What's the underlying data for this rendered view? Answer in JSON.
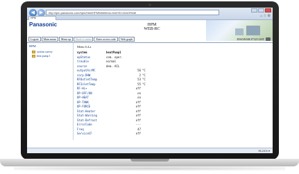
{
  "browser": {
    "address": "http://lpm.panasonic.com/hpm/html/HPMWebMenu.html?ID=DIAGRAM",
    "tab_label": "HPM",
    "back_symbol": "◀",
    "forward_symbol": "▶",
    "tool_icons": "⌂ ☆ ⚙"
  },
  "header": {
    "brand": "Panasonic",
    "title_line1": "HPM",
    "title_line2": "WEB-RC",
    "diagram_label": "DIAGRAM 4*123 LIST"
  },
  "toolbar": {
    "buttons": [
      "Logout",
      "Main menu",
      "Menu up",
      "Back to menu",
      "Enter access code",
      "Web graph"
    ]
  },
  "tree": {
    "root": "HPM",
    "items": [
      "system survey",
      "heat pump 1"
    ]
  },
  "main": {
    "menu_id": "Menu 6.4.a",
    "header_row": {
      "key": "system",
      "value": "heatPump1"
    },
    "rows": [
      {
        "key": "opStatus",
        "value": "com. oper.",
        "unit": ""
      },
      {
        "key": "trouble",
        "value": "normal",
        "unit": ""
      },
      {
        "key": "source",
        "value": "dem. ACL",
        "unit": ""
      },
      {
        "key": "outputAirMC",
        "value": "56",
        "unit": "°C"
      },
      {
        "key": "corp.DHW",
        "value": "2",
        "unit": "°C"
      },
      {
        "key": "RFOutletTemp",
        "value": "53",
        "unit": "°C"
      },
      {
        "key": "RFInletTemp",
        "value": "55",
        "unit": "°C"
      },
      {
        "key": "RF-Hi+",
        "value": "off",
        "unit": ""
      },
      {
        "key": "OP-OFF/ON",
        "value": "on",
        "unit": ""
      },
      {
        "key": "OP-HEAT",
        "value": "on",
        "unit": ""
      },
      {
        "key": "OP-TANK",
        "value": "off",
        "unit": ""
      },
      {
        "key": "OP-FORCE",
        "value": "off",
        "unit": ""
      },
      {
        "key": "Stat-Heater",
        "value": "off",
        "unit": ""
      },
      {
        "key": "Stat-Warning",
        "value": "off",
        "unit": ""
      },
      {
        "key": "Stat-Defrost",
        "value": "off",
        "unit": ""
      },
      {
        "key": "ErrorCode",
        "value": "---",
        "unit": ""
      },
      {
        "key": "Freq",
        "value": "47",
        "unit": ""
      },
      {
        "key": "ServiceCF",
        "value": "off",
        "unit": ""
      }
    ]
  },
  "status": {
    "zoom": "95,24% ▾"
  }
}
